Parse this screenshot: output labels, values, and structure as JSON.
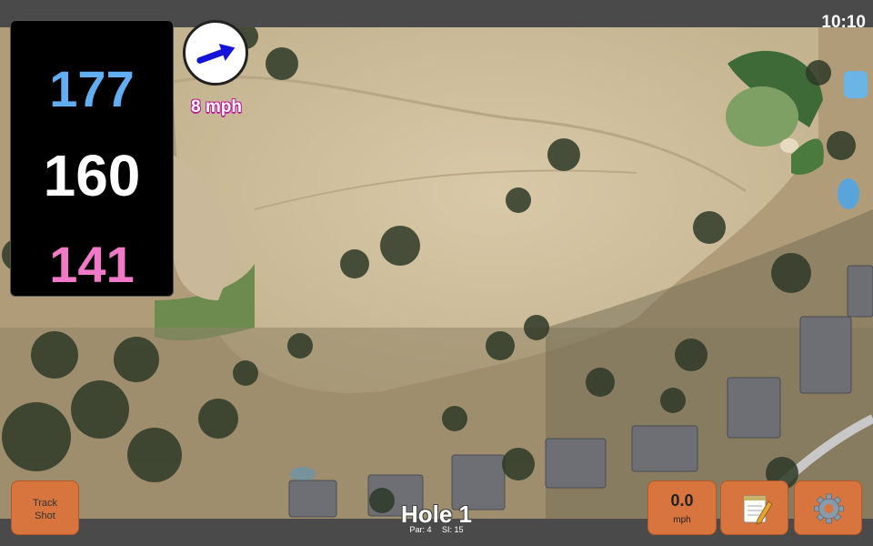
{
  "status": {
    "time": "10:10"
  },
  "distances": {
    "back": {
      "value": "177",
      "color": "#62aef2"
    },
    "middle": {
      "value": "160",
      "color": "#ffffff"
    },
    "front": {
      "value": "141",
      "color": "#f07ac8"
    }
  },
  "wind": {
    "speed_label": "8 mph",
    "arrow_color": "#1414d8"
  },
  "hole": {
    "title": "Hole 1",
    "par": "Par: 4",
    "si": "SI: 15"
  },
  "buttons": {
    "track_shot_line1": "Track",
    "track_shot_line2": "Shot",
    "speed_value": "0.0",
    "speed_unit": "mph",
    "notes_icon": "notepad-icon",
    "settings_icon": "gear-icon"
  },
  "colors": {
    "button": "#d8743e",
    "bar": "#4a4a4a"
  }
}
